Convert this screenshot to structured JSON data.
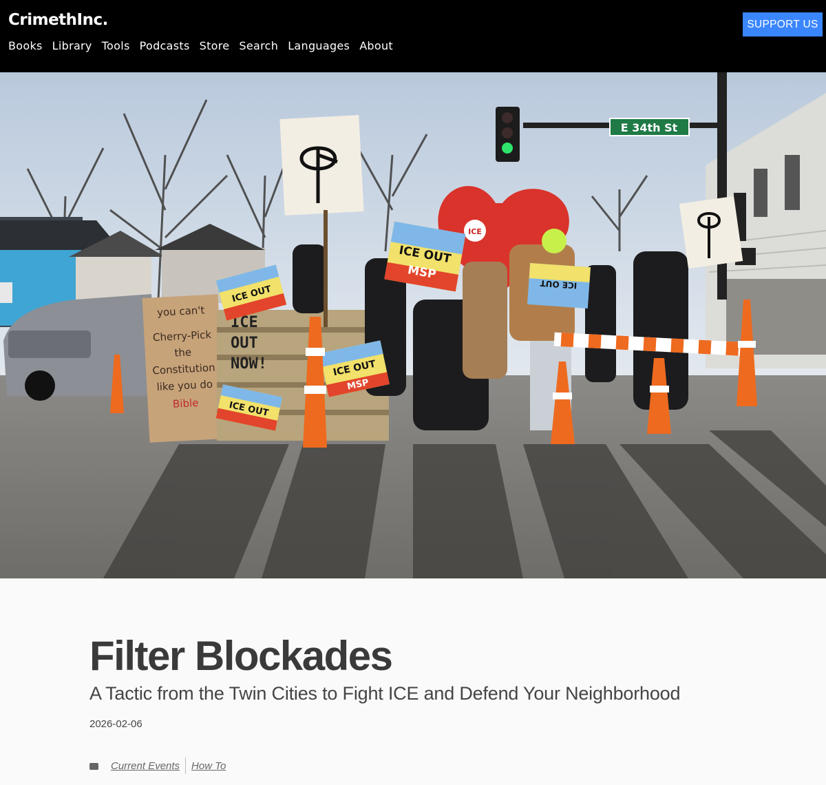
{
  "header": {
    "logo": "CrimethInc.",
    "support_label": "SUPPORT US",
    "nav": [
      "Books",
      "Library",
      "Tools",
      "Podcasts",
      "Store",
      "Search",
      "Languages",
      "About"
    ]
  },
  "hero": {
    "street_sign": "E 34th St",
    "signs": {
      "ice_out": "ICE OUT",
      "msp": "MSP",
      "cardboard": [
        "you can't",
        "Cherry-Pick",
        "the",
        "Constitution",
        "like you do",
        "Bible"
      ],
      "pallet": [
        "ICE",
        "OUT",
        "NOW!"
      ],
      "heart_label": "ICE"
    }
  },
  "article": {
    "title": "Filter Blockades",
    "subtitle": "A Tactic from the Twin Cities to Fight ICE and Defend Your Neighborhood",
    "date": "2026-02-06",
    "tags": [
      "Current Events",
      "How To"
    ]
  },
  "colors": {
    "header_bg": "#000000",
    "support_bg": "#3a86ff",
    "page_bg": "#fafafa"
  }
}
